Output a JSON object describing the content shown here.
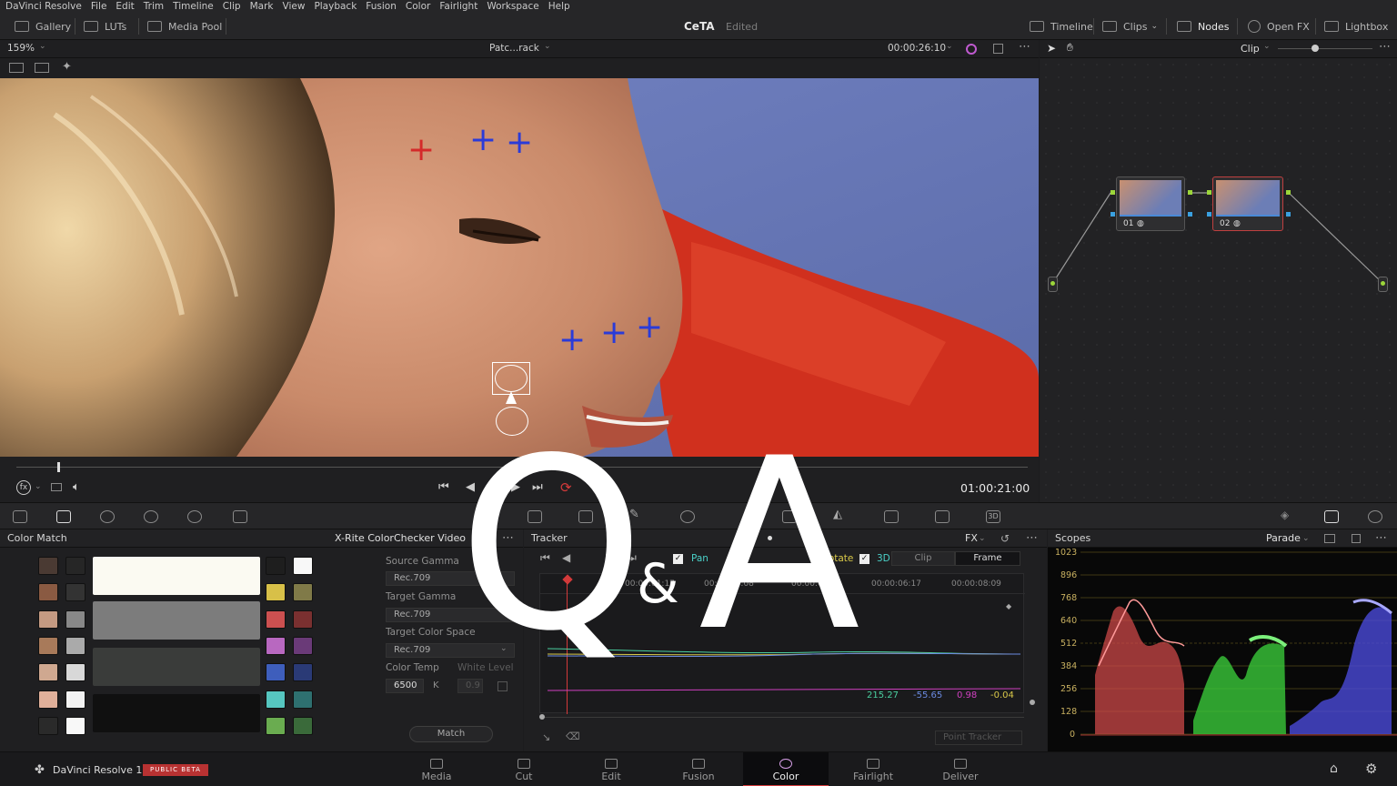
{
  "menubar": {
    "items": [
      "DaVinci Resolve",
      "File",
      "Edit",
      "Trim",
      "Timeline",
      "Clip",
      "Mark",
      "View",
      "Playback",
      "Fusion",
      "Color",
      "Fairlight",
      "Workspace",
      "Help"
    ]
  },
  "toolbar": {
    "gallery": "Gallery",
    "luts": "LUTs",
    "media_pool": "Media Pool",
    "project_title": "CeTA",
    "project_status": "Edited",
    "timeline": "Timeline",
    "clips": "Clips",
    "nodes": "Nodes",
    "open_fx": "Open FX",
    "lightbox": "Lightbox"
  },
  "viewer": {
    "zoom": "159%",
    "clip_name": "Patc...rack",
    "timecode": "00:00:26:10",
    "playhead_timecode": "01:00:21:00"
  },
  "nodes": {
    "mode": "Clip",
    "node1_label": "01",
    "node2_label": "02"
  },
  "color_match": {
    "title": "Color Match",
    "chart": "X-Rite ColorChecker Video",
    "source_gamma_label": "Source Gamma",
    "source_gamma": "Rec.709",
    "target_gamma_label": "Target Gamma",
    "target_gamma": "Rec.709",
    "target_cs_label": "Target Color Space",
    "target_cs": "Rec.709",
    "color_temp_label": "Color Temp",
    "color_temp": "6500",
    "color_temp_unit": "K",
    "white_level_label": "White Level",
    "white_level": "0.9",
    "match_button": "Match",
    "swatches_left": [
      "#4a3a33",
      "#8a5a42",
      "#c49a82",
      "#a87a5a",
      "#cfa890",
      "#e0b09a",
      "#2a2a2a"
    ],
    "swatches_left2": [
      "#262626",
      "#333",
      "#888",
      "#aaa",
      "#d8d8d8",
      "#f2f2f2",
      "#f8f8f8"
    ],
    "swatches_right": [
      "#1e1e1e",
      "#d8c048",
      "#cc5050",
      "#b868c0",
      "#3e5ebc",
      "#56c6c0",
      "#6aac50"
    ],
    "swatches_right2": [
      "#f8f8f8",
      "#807a48",
      "#7a3030",
      "#6a3a78",
      "#2a3a76",
      "#2e7070",
      "#3a6a3a"
    ]
  },
  "tracker": {
    "title": "Tracker",
    "fx": "FX",
    "pan": "Pan",
    "rotate": "Rotate",
    "three_d": "3D",
    "clip": "Clip",
    "frame": "Frame",
    "ruler": [
      "00:00:01:17",
      "00:00:03:08",
      "00:00:04:18",
      "00:00:06:17",
      "00:00:08:09"
    ],
    "values": [
      "215.27",
      "-55.65",
      "0.98",
      "-0.04"
    ],
    "point_tracker": "Point Tracker"
  },
  "scopes": {
    "title": "Scopes",
    "mode": "Parade",
    "scale": [
      "1023",
      "896",
      "768",
      "640",
      "512",
      "384",
      "256",
      "128",
      "0"
    ]
  },
  "bottom": {
    "app_name": "DaVinci Resolve 17",
    "badge": "PUBLIC BETA",
    "pages": [
      "Media",
      "Cut",
      "Edit",
      "Fusion",
      "Color",
      "Fairlight",
      "Deliver"
    ]
  },
  "overlay": {
    "q": "Q",
    "amp": "&",
    "a": "A"
  },
  "colors": {
    "accent": "#d33a3a",
    "active_page": "#e6e6e6",
    "tracker_blue": "#2a3bd8"
  }
}
